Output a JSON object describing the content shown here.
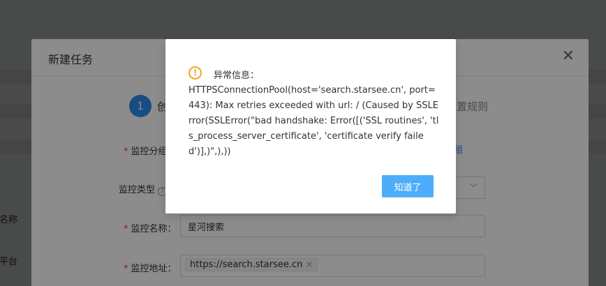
{
  "background": {
    "label_name": "控名称",
    "label_platform": "标平台"
  },
  "task_dialog": {
    "title": "新建任务",
    "close_icon": "close-icon",
    "step1_number": "1",
    "step1_label": "创",
    "step3_label": "设置规则",
    "fields": {
      "category_label": "监控分组",
      "category_link": "组",
      "type_label": "监控类型",
      "name_label": "监控名称：",
      "name_value": "星河搜索",
      "address_label": "监控地址：",
      "address_tag": "https://search.starsee.cn",
      "address_tag_remove": "×"
    }
  },
  "alert": {
    "icon": "warning-icon",
    "icon_glyph": "!",
    "title": "异常信息：",
    "message": "HTTPSConnectionPool(host='search.starsee.cn', port=443): Max retries exceeded with url: / (Caused by SSLError(SSLError(\"bad handshake: Error([('SSL routines', 'tls_process_server_certificate', 'certificate verify failed')],)\",),))",
    "ok_button": "知道了",
    "accent_color": "#4eadfa",
    "warning_color": "#f5a623"
  }
}
